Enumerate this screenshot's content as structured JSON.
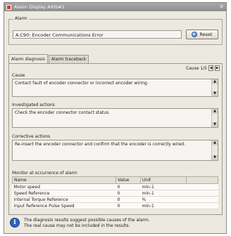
{
  "window": {
    "title": "Alarm Display AXIS#1"
  },
  "alarm": {
    "legend": "Alarm",
    "value": "A.C90: Encoder Communications Error",
    "reset_label": "Reset"
  },
  "tabs": [
    {
      "label": "Alarm diagnosis",
      "active": true
    },
    {
      "label": "Alarm traceback",
      "active": false
    }
  ],
  "diagnosis": {
    "cause_counter": "Cause 1/5",
    "cause_label": "Cause",
    "cause_text": "Contact fault of encoder connector or incorrect encoder wiring.",
    "investigated_label": "Investigated actions",
    "investigated_text": "Check the encoder connector contact status.",
    "corrective_label": "Corrective actions",
    "corrective_text": "Re-insert the encoder connector and confirm that the encoder is correctly wired.",
    "monitor_label": "Monitor at occurrence of alarm"
  },
  "monitor_table": {
    "columns": [
      "Name",
      "Value",
      "Unit"
    ],
    "rows": [
      {
        "name": "Motor speed",
        "value": "0",
        "unit": "min-1"
      },
      {
        "name": "Speed Reference",
        "value": "0",
        "unit": "min-1"
      },
      {
        "name": "Internal Torque Reference",
        "value": "0",
        "unit": "%"
      },
      {
        "name": "Input Reference Pulse Speed",
        "value": "0",
        "unit": "min-1"
      }
    ]
  },
  "info": {
    "line1": "The diagnosis results suggest possible causes of the alarm.",
    "line2": "The real cause may not be included in the results."
  }
}
